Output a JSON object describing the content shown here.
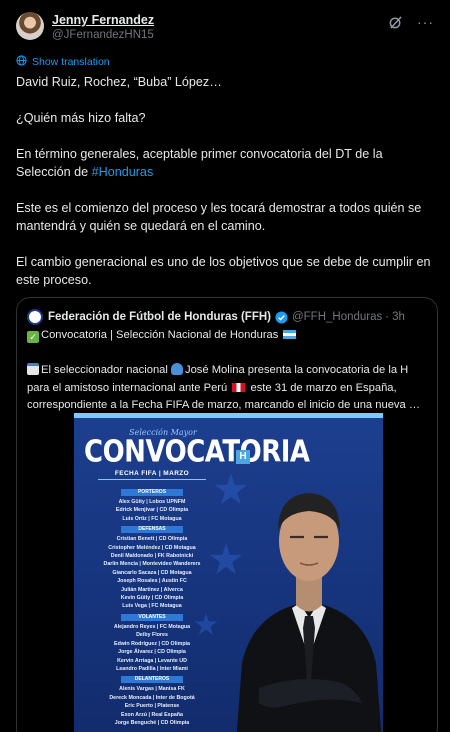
{
  "author": {
    "name": "Jenny Fernandez",
    "handle": "@JFernandezHN15"
  },
  "header": {
    "grok_icon": "grok-icon",
    "more_label": "···"
  },
  "translate_label": "Show translation",
  "tweet": {
    "p1": "David Ruiz, Rochez, “Buba” López…",
    "p2": "¿Quién más hizo falta?",
    "p3_pre": "En término generales, aceptable primer convocatoria del DT de la Selección de ",
    "p3_tag": "#Honduras",
    "p4": "Este es el comienzo del proceso y les tocará demostrar a todos quién se mantendrá y quién se quedará en el camino.",
    "p5": "El cambio generacional es uno de los objetivos que se debe de cumplir en este proceso."
  },
  "quote": {
    "name": "Federación de Fútbol de Honduras (FFH)",
    "handle": "@FFH_Honduras",
    "sep": "·",
    "time": "3h",
    "line1": "Convocatoria | Selección Nacional de Honduras",
    "body_a": "El seleccionador nacional ",
    "body_b": "José Molina presenta la convocatoria de la H para el amistoso internacional ante Perú ",
    "body_c": " este 31 de marzo en España, correspondiente a la Fecha FIFA de marzo, marcando el inicio de una nueva …",
    "colors": {
      "verified": "#1d9bf0",
      "link": "#1d9bf0",
      "honduras_blue": "#4aa7e0"
    }
  },
  "poster": {
    "accent": "Selección Mayor",
    "title": "CONVOCATORIA",
    "title_badge": "H",
    "subtitle": "FECHA FIFA | MARZO",
    "sections": [
      {
        "label": "PORTEROS",
        "players": [
          "Alex Güity | Lobos UPNFM",
          "Edrick Menjívar | CD Olimpia",
          "Luis Ortiz | FC Motagua"
        ]
      },
      {
        "label": "DEFENSAS",
        "players": [
          "Cristian Benett | CD Olimpia",
          "Cristopher Meléndez | CD Motagua",
          "Denil Maldonado | FK Rabotnicki",
          "Darlin Mencia | Montevideo Wanderers",
          "Giancarlo Sacaza | CD Motagua",
          "Joseph Rosales | Austin FC",
          "Julián Martínez | Alverca",
          "Kevin Güity | CD Olimpia",
          "Luis Vega | FC Motagua"
        ]
      },
      {
        "label": "VOLANTES",
        "players": [
          "Alejandro Reyes | FC Motagua",
          "Deiby Flores",
          "Edwin Rodríguez | CD Olimpia",
          "Jorge Álvarez | CD Olimpia",
          "Kervin Arriaga | Levante UD",
          "Leandro Padilla | Inter Miami"
        ]
      },
      {
        "label": "DELANTEROS",
        "players": [
          "Alenis Vargas | Manisa FK",
          "Dereck Moncada | Inter de Bogotá",
          "Eric Puerto | Platense",
          "Exon Arzú | Real España",
          "Jorge Benguché | CD Olimpia"
        ]
      }
    ]
  }
}
